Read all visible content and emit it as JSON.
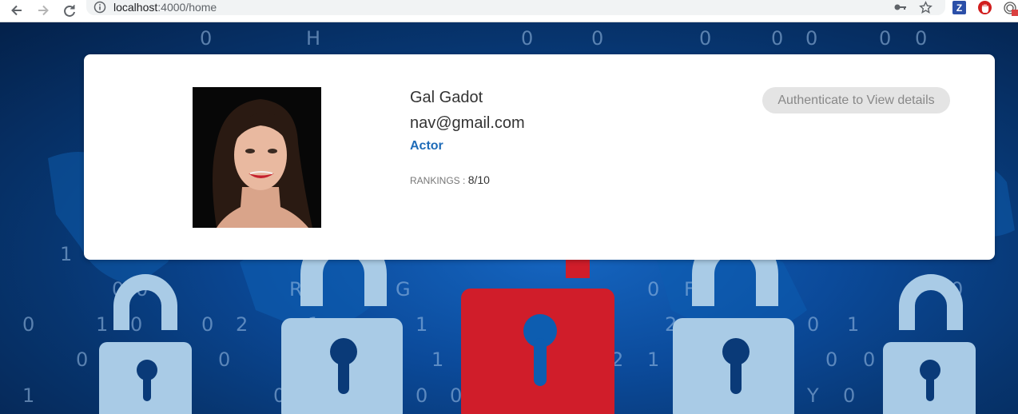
{
  "browser": {
    "url_host": "localhost",
    "url_rest": ":4000/home"
  },
  "profile": {
    "name": "Gal Gadot",
    "email": "nav@gmail.com",
    "role": "Actor",
    "rankings_label": "RANKINGS :",
    "rankings_value": "8/10",
    "auth_button": "Authenticate to View details"
  },
  "background_digits": [
    "0",
    "H",
    "0",
    "0",
    "0",
    "0",
    "0",
    "0",
    "0",
    "1",
    "0",
    "0",
    "R",
    "G",
    "0",
    "F",
    "0",
    "0",
    "1",
    "0",
    "0",
    "2",
    "1",
    "1",
    "2",
    "0",
    "1",
    "0",
    "H",
    "0",
    "2",
    "0",
    "0",
    "1",
    "0",
    "1",
    "2",
    "1",
    "0",
    "1",
    "0",
    "0",
    "1",
    "0",
    "0",
    "1",
    "0",
    "0",
    "0",
    "0",
    "H",
    "Y",
    "0"
  ],
  "colors": {
    "accent_role": "#1e6bb8",
    "lock_light": "#a9cbe6",
    "lock_red": "#d01d2a",
    "button_bg": "#e4e4e4"
  }
}
